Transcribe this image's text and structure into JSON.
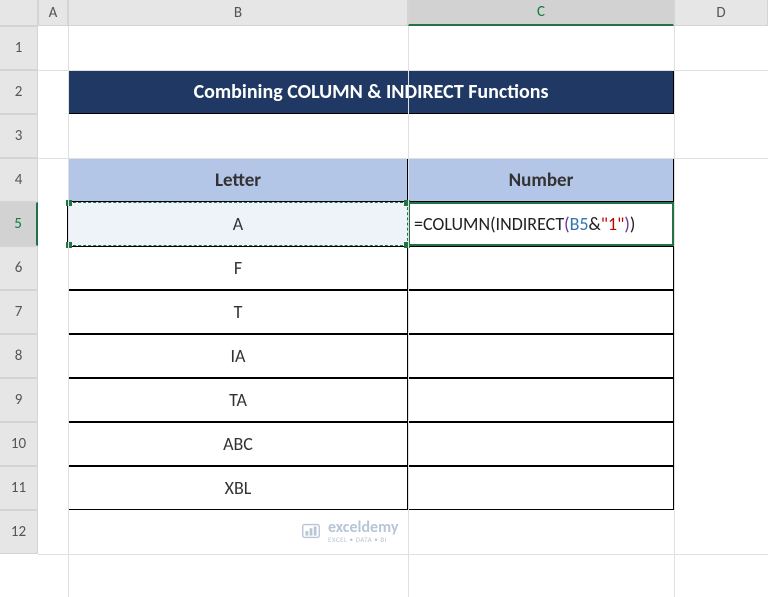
{
  "columns": [
    "",
    "A",
    "B",
    "C",
    "D"
  ],
  "rows": [
    "1",
    "2",
    "3",
    "4",
    "5",
    "6",
    "7",
    "8",
    "9",
    "10",
    "11",
    "12"
  ],
  "activeCol": "C",
  "activeRow": "5",
  "title": "Combining COLUMN & INDIRECT Functions",
  "headers": {
    "letter": "Letter",
    "number": "Number"
  },
  "data": {
    "b5": "A",
    "b6": "F",
    "b7": "T",
    "b8": "IA",
    "b9": "TA",
    "b10": "ABC",
    "b11": "XBL"
  },
  "formula": {
    "eq": "=",
    "fn1": "COLUMN",
    "op1": "(",
    "fn2": "INDIRECT",
    "op2": "(",
    "ref": "B5",
    "amp": "&",
    "str": "\"1\"",
    "cp2": ")",
    "cp1": ")"
  },
  "watermark": {
    "name": "exceldemy",
    "tag": "EXCEL • DATA • BI"
  },
  "chart_data": {
    "type": "table",
    "title": "Combining COLUMN & INDIRECT Functions",
    "columns": [
      "Letter",
      "Number"
    ],
    "rows": [
      [
        "A",
        "=COLUMN(INDIRECT(B5&\"1\"))"
      ],
      [
        "F",
        ""
      ],
      [
        "T",
        ""
      ],
      [
        "IA",
        ""
      ],
      [
        "TA",
        ""
      ],
      [
        "ABC",
        ""
      ],
      [
        "XBL",
        ""
      ]
    ]
  }
}
